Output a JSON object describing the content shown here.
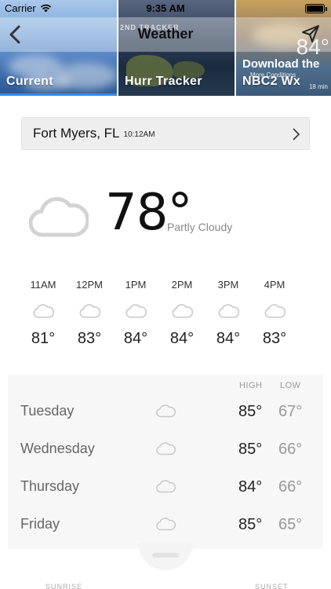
{
  "status_bar": {
    "carrier": "Carrier",
    "time": "9:35 AM"
  },
  "nav": {
    "title": "Weather"
  },
  "tabs": [
    {
      "label": "Current",
      "active": true
    },
    {
      "label": "Hurr Tracker",
      "active": false
    },
    {
      "label": "NBC2 Wx",
      "active": false
    }
  ],
  "tab_previews": {
    "hurr_banner": "2ND TRACKER",
    "nbc_download": "Download the",
    "nbc_big_temp": "84°",
    "nbc_more": "More Conditions",
    "nbc_time": "18 min"
  },
  "location": {
    "city": "Fort Myers, FL",
    "time": "10:12AM"
  },
  "current": {
    "temperature": "78°",
    "condition": "Partly Cloudy",
    "icon": "cloud-icon"
  },
  "hourly": [
    {
      "time": "11AM",
      "temp": "81°",
      "icon": "cloud-icon"
    },
    {
      "time": "12PM",
      "temp": "83°",
      "icon": "cloud-icon"
    },
    {
      "time": "1PM",
      "temp": "84°",
      "icon": "cloud-icon"
    },
    {
      "time": "2PM",
      "temp": "84°",
      "icon": "cloud-icon"
    },
    {
      "time": "3PM",
      "temp": "84°",
      "icon": "cloud-icon"
    },
    {
      "time": "4PM",
      "temp": "83°",
      "icon": "cloud-icon"
    }
  ],
  "daily": {
    "high_label": "HIGH",
    "low_label": "LOW",
    "days": [
      {
        "day": "Tuesday",
        "high": "85°",
        "low": "67°",
        "icon": "cloud-icon"
      },
      {
        "day": "Wednesday",
        "high": "85°",
        "low": "66°",
        "icon": "cloud-icon"
      },
      {
        "day": "Thursday",
        "high": "84°",
        "low": "66°",
        "icon": "cloud-icon"
      },
      {
        "day": "Friday",
        "high": "85°",
        "low": "65°",
        "icon": "cloud-icon"
      }
    ]
  },
  "sun": {
    "sunrise_label": "SUNRISE",
    "sunset_label": "SUNSET"
  },
  "colors": {
    "accent": "#3a8be6",
    "icon_gray": "#c8c8c8"
  }
}
